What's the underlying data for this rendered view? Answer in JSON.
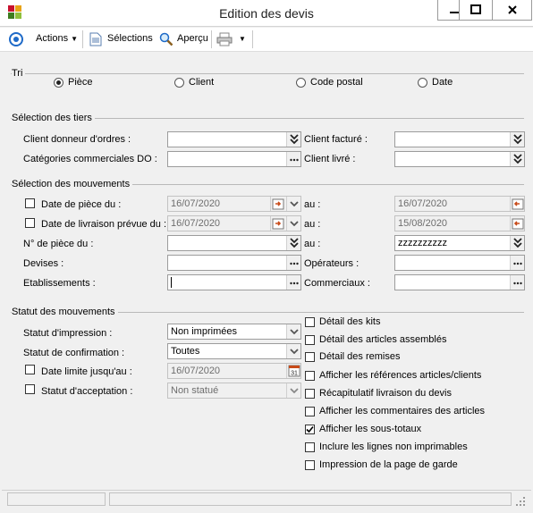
{
  "window": {
    "title": "Edition des devis"
  },
  "toolbar": {
    "actions_label": "Actions",
    "selections_label": "Sélections",
    "apercu_label": "Aperçu"
  },
  "tri": {
    "label": "Tri",
    "options": [
      "Pièce",
      "Client",
      "Code postal",
      "Date"
    ],
    "selected": "Pièce"
  },
  "tiers": {
    "label": "Sélection des tiers",
    "client_donneur_label": "Client donneur d'ordres :",
    "client_donneur_value": "",
    "categories_label": "Catégories commerciales DO :",
    "categories_value": "",
    "client_facture_label": "Client facturé :",
    "client_facture_value": "",
    "client_livre_label": "Client livré :",
    "client_livre_value": ""
  },
  "mouvements": {
    "label": "Sélection des mouvements",
    "date_piece_label": "Date de pièce du :",
    "date_piece_from": "16/07/2020",
    "date_piece_to": "16/07/2020",
    "date_livraison_label": "Date de livraison prévue du :",
    "date_livraison_from": "16/07/2020",
    "date_livraison_to": "15/08/2020",
    "numero_label": "N° de pièce du :",
    "numero_from": "",
    "numero_to": "zzzzzzzzzz",
    "au_label": "au :",
    "devises_label": "Devises :",
    "devises_value": "",
    "operateurs_label": "Opérateurs :",
    "operateurs_value": "",
    "etablissements_label": "Etablissements :",
    "etablissements_value": "",
    "commerciaux_label": "Commerciaux :",
    "commerciaux_value": ""
  },
  "statut": {
    "label": "Statut des mouvements",
    "impression_label": "Statut d'impression :",
    "impression_value": "Non imprimées",
    "confirmation_label": "Statut de confirmation :",
    "confirmation_value": "Toutes",
    "date_limite_label": "Date limite jusqu'au :",
    "date_limite_value": "16/07/2020",
    "acceptation_label": "Statut d'acceptation :",
    "acceptation_value": "Non statué"
  },
  "options": [
    {
      "label": "Détail des kits",
      "checked": false
    },
    {
      "label": "Détail des articles assemblés",
      "checked": false
    },
    {
      "label": "Détail des remises",
      "checked": false
    },
    {
      "label": "Afficher les références articles/clients",
      "checked": false
    },
    {
      "label": "Récapitulatif livraison du devis",
      "checked": false
    },
    {
      "label": "Afficher les commentaires des articles",
      "checked": false
    },
    {
      "label": "Afficher les sous-totaux",
      "checked": true
    },
    {
      "label": "Inclure les lignes non imprimables",
      "checked": false
    },
    {
      "label": "Impression de la page de garde",
      "checked": false
    }
  ],
  "colors": {
    "window_bg": "#f0f0f0",
    "field_border": "#9c9c9c",
    "accent": "#1e6ac8"
  }
}
